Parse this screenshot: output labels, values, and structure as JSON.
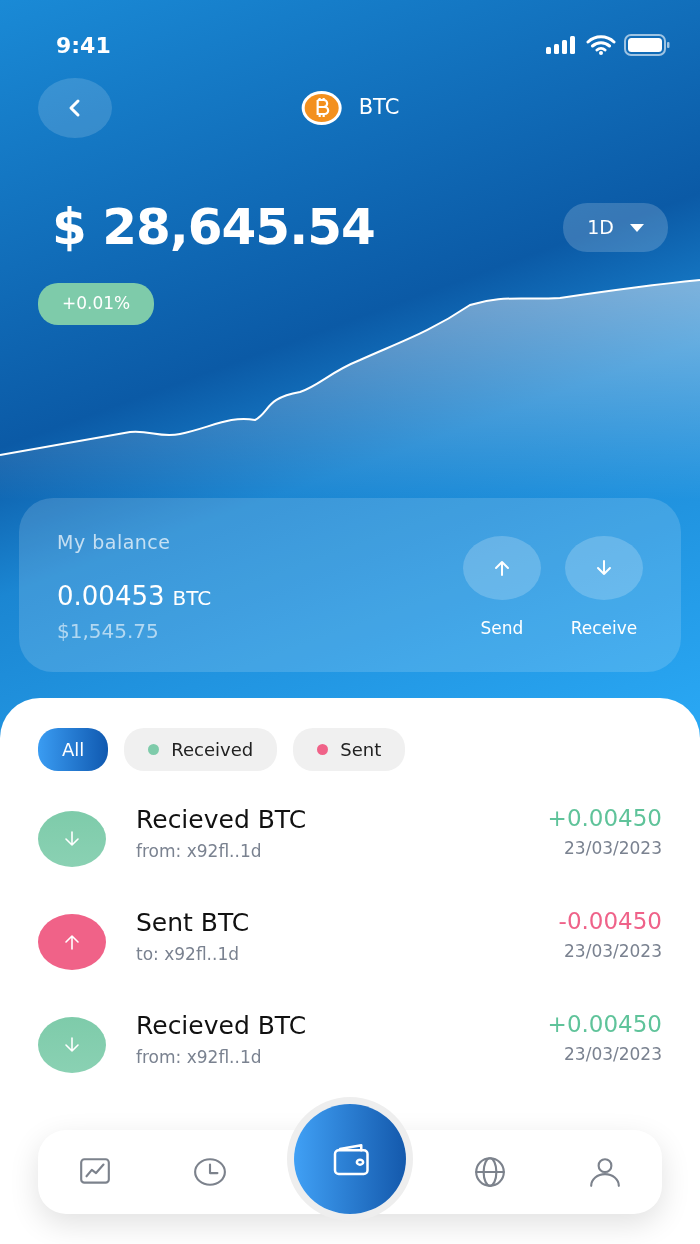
{
  "status_bar": {
    "time": "9:41"
  },
  "header": {
    "title": "BTC"
  },
  "price": {
    "value": "$ 28,645.54",
    "change": "+0.01%",
    "period": "1D"
  },
  "balance": {
    "label": "My balance",
    "amount": "0.00453",
    "unit": "BTC",
    "fiat": "$1,545.75",
    "actions": [
      {
        "kind": "send",
        "label": "Send"
      },
      {
        "kind": "receive",
        "label": "Receive"
      }
    ]
  },
  "filters": [
    {
      "label": "All",
      "selected": true
    },
    {
      "label": "Received",
      "selected": false,
      "color": "#7ecbaa"
    },
    {
      "label": "Sent",
      "selected": false,
      "color": "#f06288"
    }
  ],
  "transactions": [
    {
      "kind": "received",
      "title": "Recieved BTC",
      "address": "from: x92fl..1d",
      "amount": "+0.00450",
      "date": "23/03/2023"
    },
    {
      "kind": "sent",
      "title": "Sent BTC",
      "address": "to: x92fl..1d",
      "amount": "-0.00450",
      "date": "23/03/2023"
    },
    {
      "kind": "received",
      "title": "Recieved BTC",
      "address": "from: x92fl..1d",
      "amount": "+0.00450",
      "date": "23/03/2023"
    }
  ],
  "tab_bar": [
    {
      "kind": "chart",
      "selected": false
    },
    {
      "kind": "history",
      "selected": false
    },
    {
      "kind": "wallet",
      "selected": true
    },
    {
      "kind": "globe",
      "selected": false
    },
    {
      "kind": "profile",
      "selected": false
    }
  ]
}
